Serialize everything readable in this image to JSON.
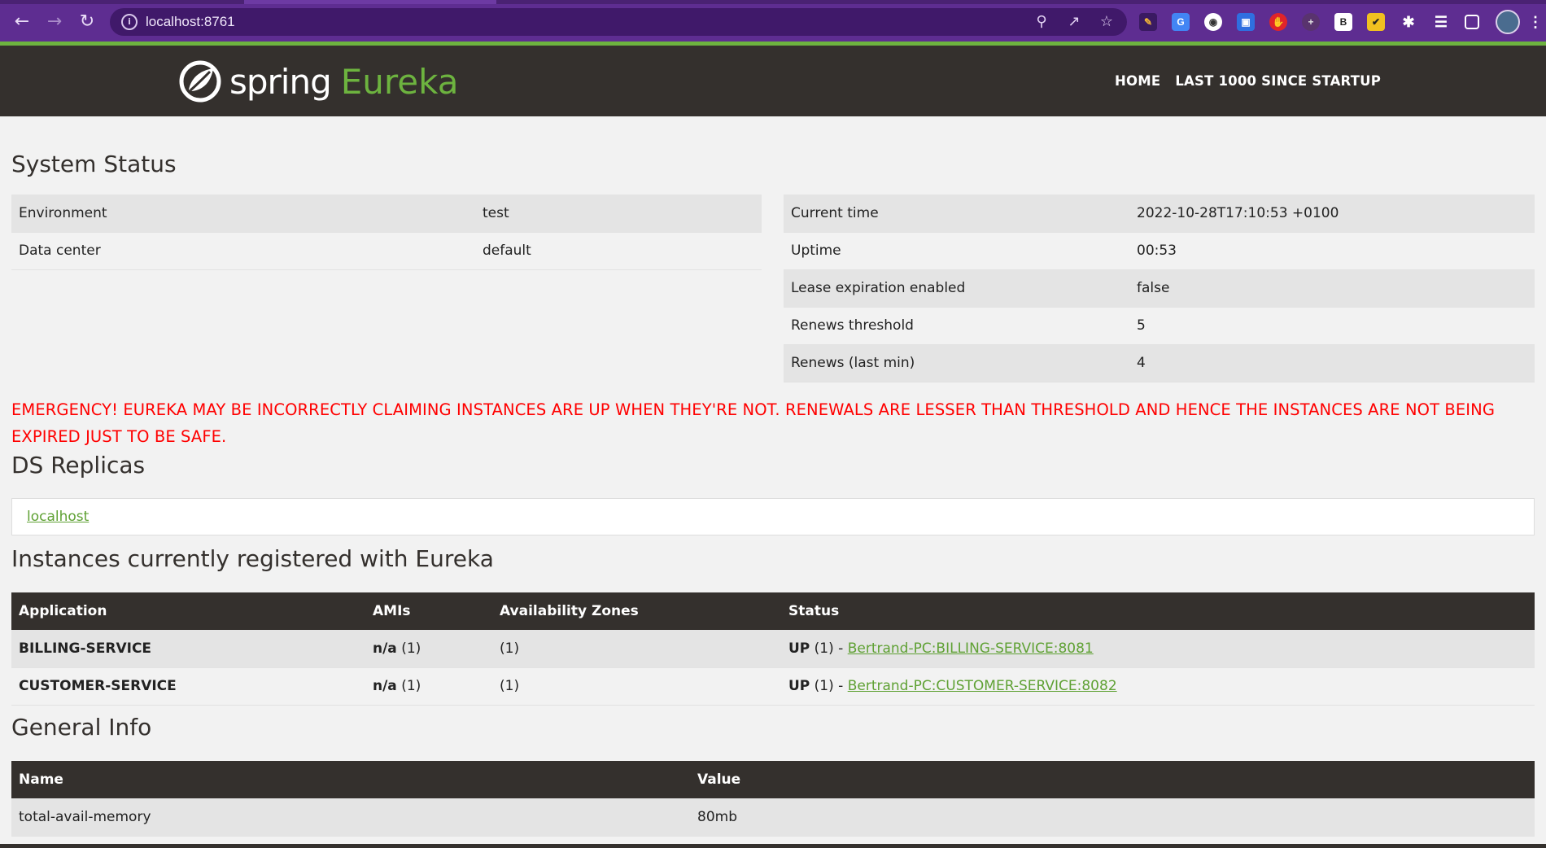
{
  "browser": {
    "url": "localhost:8761"
  },
  "navbar": {
    "brand_spring": "spring",
    "brand_eureka": "Eureka",
    "links": [
      "HOME",
      "LAST 1000 SINCE STARTUP"
    ]
  },
  "system_status": {
    "title": "System Status",
    "left": [
      {
        "key": "Environment",
        "value": "test"
      },
      {
        "key": "Data center",
        "value": "default"
      }
    ],
    "right": [
      {
        "key": "Current time",
        "value": "2022-10-28T17:10:53 +0100"
      },
      {
        "key": "Uptime",
        "value": "00:53"
      },
      {
        "key": "Lease expiration enabled",
        "value": "false"
      },
      {
        "key": "Renews threshold",
        "value": "5"
      },
      {
        "key": "Renews (last min)",
        "value": "4"
      }
    ]
  },
  "emergency": "EMERGENCY! EUREKA MAY BE INCORRECTLY CLAIMING INSTANCES ARE UP WHEN THEY'RE NOT. RENEWALS ARE LESSER THAN THRESHOLD AND HENCE THE INSTANCES ARE NOT BEING EXPIRED JUST TO BE SAFE.",
  "ds_replicas": {
    "title": "DS Replicas",
    "replica": "localhost"
  },
  "instances": {
    "title": "Instances currently registered with Eureka",
    "headers": [
      "Application",
      "AMIs",
      "Availability Zones",
      "Status"
    ],
    "rows": [
      {
        "application": "BILLING-SERVICE",
        "amis_bold": "n/a",
        "amis_count": "(1)",
        "zones": "(1)",
        "status_bold": "UP",
        "status_rest": "(1) - ",
        "instance_link": "Bertrand-PC:BILLING-SERVICE:8081"
      },
      {
        "application": "CUSTOMER-SERVICE",
        "amis_bold": "n/a",
        "amis_count": "(1)",
        "zones": "(1)",
        "status_bold": "UP",
        "status_rest": "(1) - ",
        "instance_link": "Bertrand-PC:CUSTOMER-SERVICE:8082"
      }
    ]
  },
  "general_info": {
    "title": "General Info",
    "headers": [
      "Name",
      "Value"
    ],
    "rows": [
      {
        "name": "total-avail-memory",
        "value": "80mb"
      }
    ]
  },
  "colors": {
    "chrome": "#5e2d91",
    "navbar": "#34302d",
    "spring_green": "#6db33f",
    "emergency_red": "#ff0000"
  }
}
